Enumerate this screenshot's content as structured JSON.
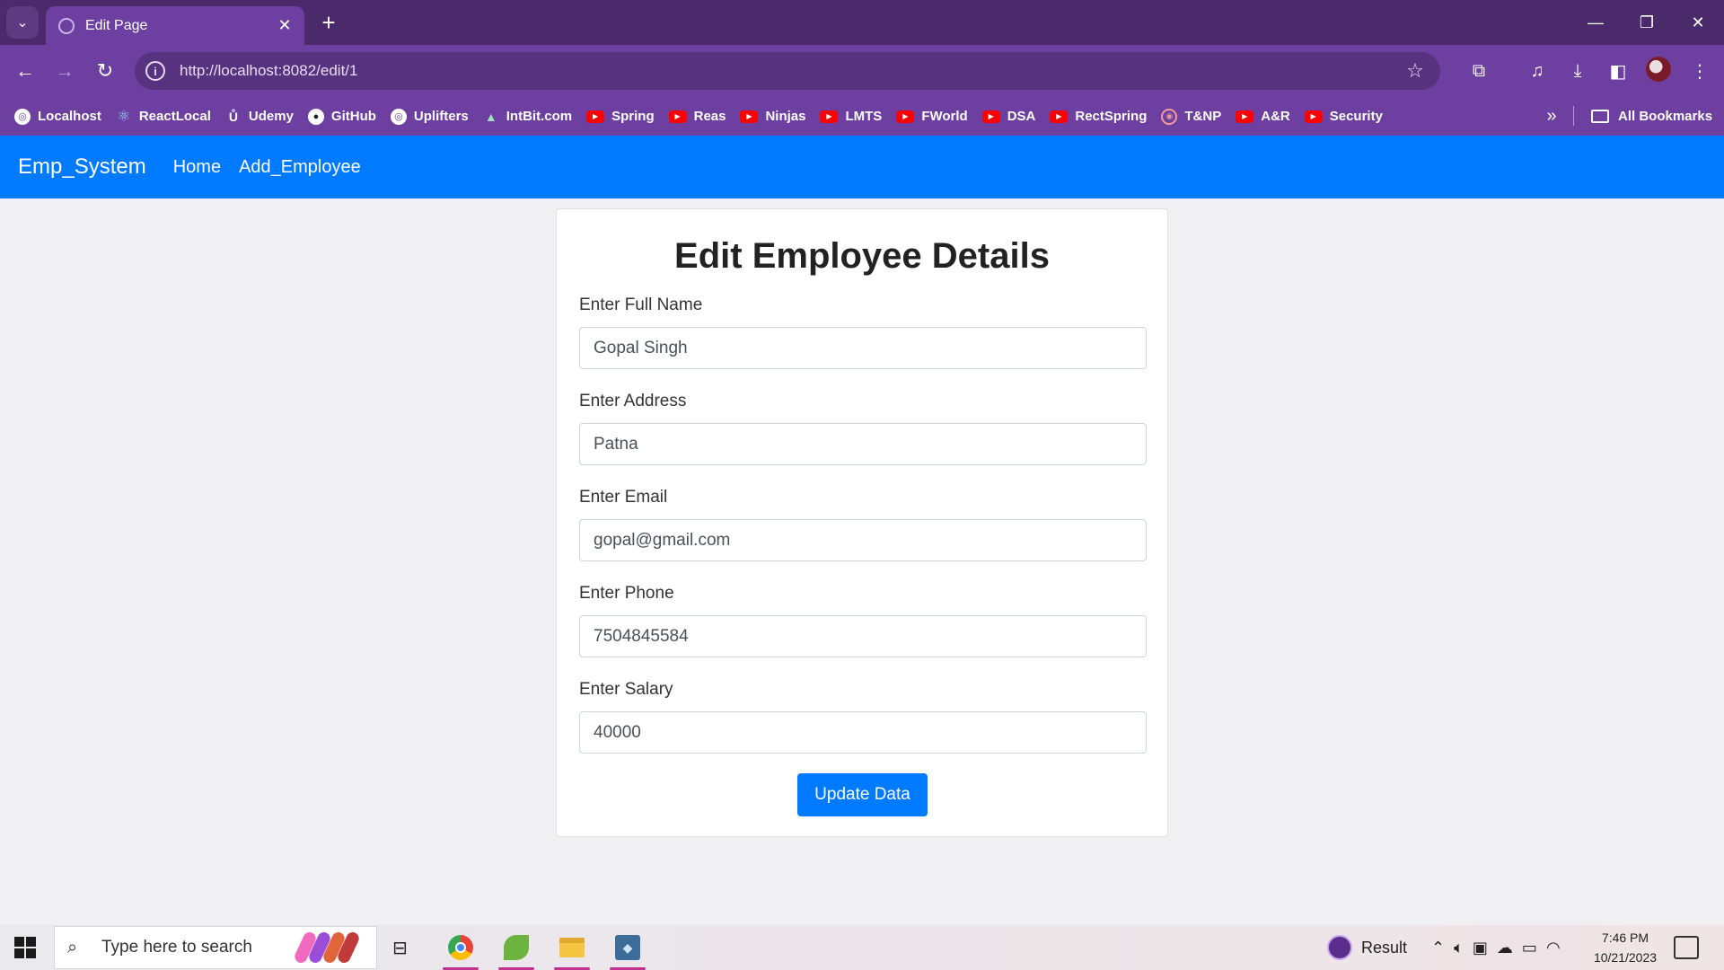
{
  "browser": {
    "tab_title": "Edit Page",
    "tab_close": "✕",
    "new_tab": "+",
    "tab_search": "⌄",
    "url": "http://localhost:8082/edit/1",
    "window": {
      "minimize": "—",
      "restore": "❐",
      "close": "✕"
    },
    "bookmarks": [
      {
        "label": "Localhost",
        "icon": "globe-icon"
      },
      {
        "label": "ReactLocal",
        "icon": "react-icon"
      },
      {
        "label": "Udemy",
        "icon": "udemy-icon"
      },
      {
        "label": "GitHub",
        "icon": "github-icon"
      },
      {
        "label": "Uplifters",
        "icon": "globe-icon"
      },
      {
        "label": "IntBit.com",
        "icon": "mountain-icon"
      },
      {
        "label": "Spring",
        "icon": "youtube-icon"
      },
      {
        "label": "Reas",
        "icon": "youtube-icon"
      },
      {
        "label": "Ninjas",
        "icon": "youtube-icon"
      },
      {
        "label": "LMTS",
        "icon": "youtube-icon"
      },
      {
        "label": "FWorld",
        "icon": "youtube-icon"
      },
      {
        "label": "DSA",
        "icon": "youtube-icon"
      },
      {
        "label": "RectSpring",
        "icon": "youtube-icon"
      },
      {
        "label": "T&NP",
        "icon": "tnp-icon"
      },
      {
        "label": "A&R",
        "icon": "youtube-icon"
      },
      {
        "label": "Security",
        "icon": "youtube-icon"
      }
    ],
    "bookmarks_more": "»",
    "all_bookmarks": "All Bookmarks",
    "theme_color": "#6d3fa0"
  },
  "app": {
    "brand": "Emp_System",
    "nav": {
      "home": "Home",
      "add": "Add_Employee"
    },
    "accent_color": "#007bff"
  },
  "form": {
    "title": "Edit Employee Details",
    "fields": [
      {
        "label": "Enter Full Name",
        "value": "Gopal Singh"
      },
      {
        "label": "Enter Address",
        "value": "Patna"
      },
      {
        "label": "Enter Email",
        "value": "gopal@gmail.com"
      },
      {
        "label": "Enter Phone",
        "value": "7504845584"
      },
      {
        "label": "Enter Salary",
        "value": "40000"
      }
    ],
    "submit_label": "Update Data"
  },
  "taskbar": {
    "search_placeholder": "Type here to search",
    "result_label": "Result",
    "time": "7:46 PM",
    "date": "10/21/2023"
  }
}
